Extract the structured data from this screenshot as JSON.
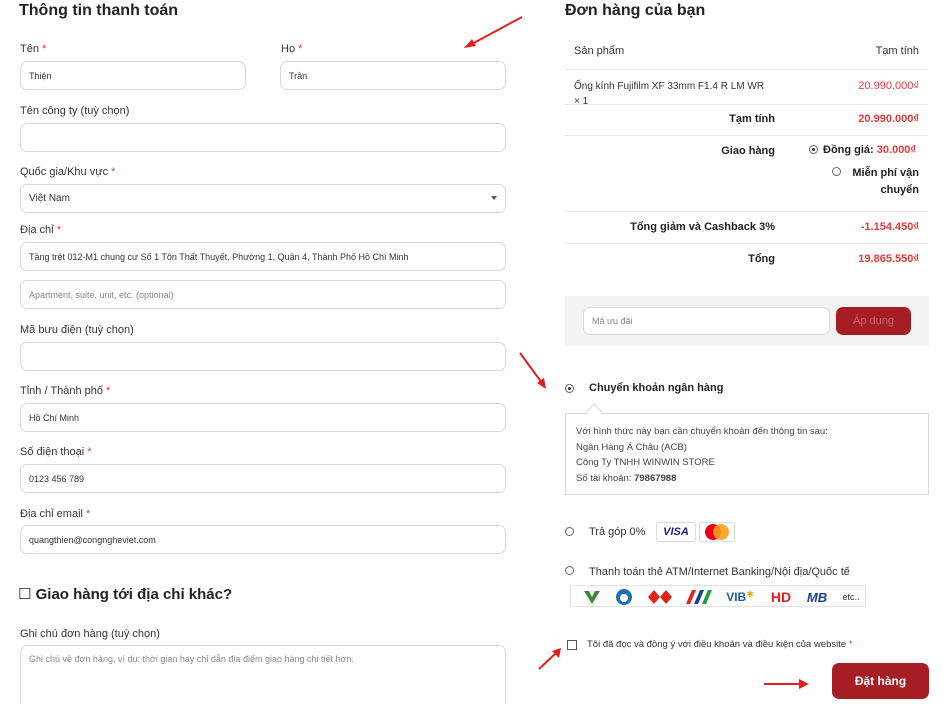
{
  "billing": {
    "title": "Thông tin thanh toán",
    "first_name": {
      "label": "Tên",
      "required": "*",
      "value": "Thiện"
    },
    "last_name": {
      "label": "Họ",
      "required": "*",
      "value": "Trần"
    },
    "company": {
      "label": "Tên công ty (tuỳ chọn)",
      "value": ""
    },
    "country": {
      "label": "Quốc gia/Khu vực",
      "required": "*",
      "value": "Việt Nam"
    },
    "address": {
      "label": "Địa chỉ",
      "required": "*",
      "value": "Tầng trệt 012-M1 chung cư Số 1 Tôn Thất Thuyết, Phường 1, Quận 4, Thành Phố Hồ Chí Minh",
      "placeholder2": "Apartment, suite, unit, etc. (optional)"
    },
    "postcode": {
      "label": "Mã bưu điện (tuỳ chọn)",
      "value": ""
    },
    "city": {
      "label": "Tỉnh / Thành phố",
      "required": "*",
      "value": "Hồ Chí Minh"
    },
    "phone": {
      "label": "Số điện thoại",
      "required": "*",
      "value": "0123 456 789"
    },
    "email": {
      "label": "Địa chỉ email",
      "required": "*",
      "value": "quangthien@congngheviet.com"
    }
  },
  "ship_other": {
    "checkbox": "☐",
    "label": "Giao hàng tới địa chỉ khác?"
  },
  "notes": {
    "label": "Ghi chú đơn hàng (tuỳ chọn)",
    "placeholder": "Ghi chú về đơn hàng, ví dụ: thời gian hay chỉ dẫn địa điểm giao hàng chi tiết hơn."
  },
  "order": {
    "title": "Đơn hàng của bạn",
    "col_product": "Sản phẩm",
    "col_subtotal": "Tạm tính",
    "product_name": "Ống kính Fujifilm XF 33mm F1.4 R LM WR",
    "product_qty": "× 1",
    "product_price": "20.990.000₫",
    "subtotal_label": "Tạm tính",
    "subtotal_value": "20.990.000₫",
    "shipping_label": "Giao hàng",
    "shipping_flat_label": "Đồng giá:",
    "shipping_flat_value": "30.000₫",
    "shipping_free_line1": "Miễn phí vận",
    "shipping_free_line2": "chuyển",
    "discount_label": "Tổng giảm và Cashback 3%",
    "discount_value": "-1.154.450₫",
    "total_label": "Tổng",
    "total_value": "19.865.550₫"
  },
  "coupon": {
    "placeholder": "Mã ưu đãi",
    "button": "Áp dụng"
  },
  "payment": {
    "bank": {
      "label": "Chuyển khoản ngân hàng",
      "line1": "Với hình thức này bạn cần chuyển khoản đến thông tin sau:",
      "line2": "Ngân Hàng Á Châu (ACB)",
      "line3": "Công Ty TNHH WINWIN STORE",
      "account_label": "Số tài khoản:",
      "account_number": "79867988"
    },
    "installment": {
      "label": "Trả góp 0%",
      "visa": "VISA",
      "mastercard": "MasterCard"
    },
    "card": {
      "label": "Thanh toán thẻ ATM/Internet Banking/Nội địa/Quốc tế",
      "banks": [
        "VIB",
        "HD",
        "MB",
        "etc.."
      ]
    }
  },
  "terms": {
    "label": "Tôi đã đọc và đồng ý với điều khoản và điều kiện của website",
    "required": "*"
  },
  "place_order": "Đặt hàng",
  "colors": {
    "accent": "#a71d24",
    "price_red": "#e03a3a",
    "arrow_red": "#e0201e"
  }
}
